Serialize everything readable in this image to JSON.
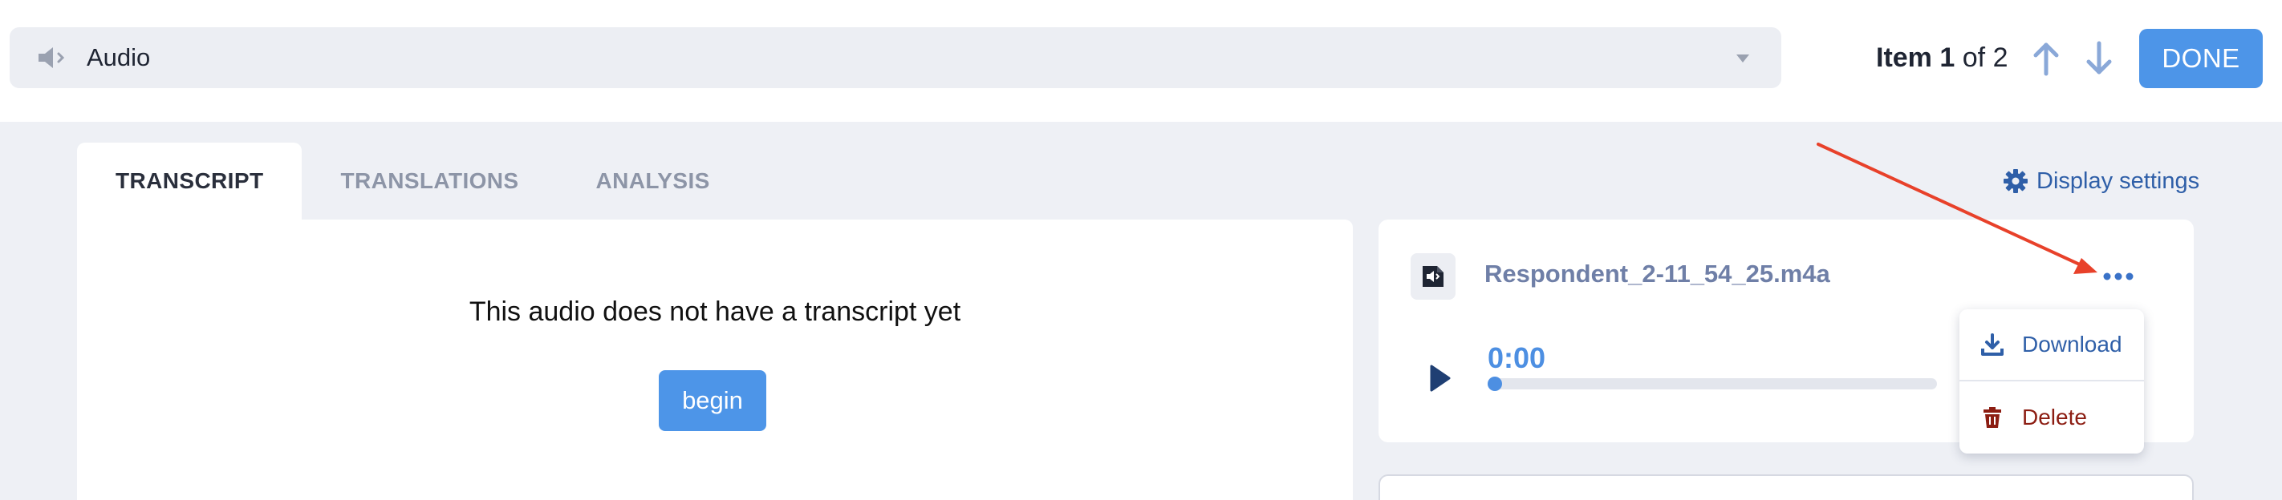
{
  "header": {
    "question_select": {
      "label": "Audio",
      "icon": "speaker-icon"
    },
    "item_counter": {
      "prefix": "Item",
      "current": "1",
      "of_label": "of",
      "total": "2"
    },
    "done_label": "DONE"
  },
  "tabs": [
    {
      "label": "TRANSCRIPT",
      "active": true
    },
    {
      "label": "TRANSLATIONS",
      "active": false
    },
    {
      "label": "ANALYSIS",
      "active": false
    }
  ],
  "display_settings_label": "Display settings",
  "transcript": {
    "empty_message": "This audio does not have a transcript yet",
    "begin_label": "begin"
  },
  "audio_card": {
    "file_name": "Respondent_2-11_54_25.m4a",
    "current_time": "0:00",
    "progress": 0
  },
  "file_menu": {
    "download_label": "Download",
    "delete_label": "Delete"
  },
  "colors": {
    "accent": "#4d95e8",
    "link": "#2f5fa8",
    "danger": "#8c1d12",
    "annotation": "#e8412a"
  }
}
